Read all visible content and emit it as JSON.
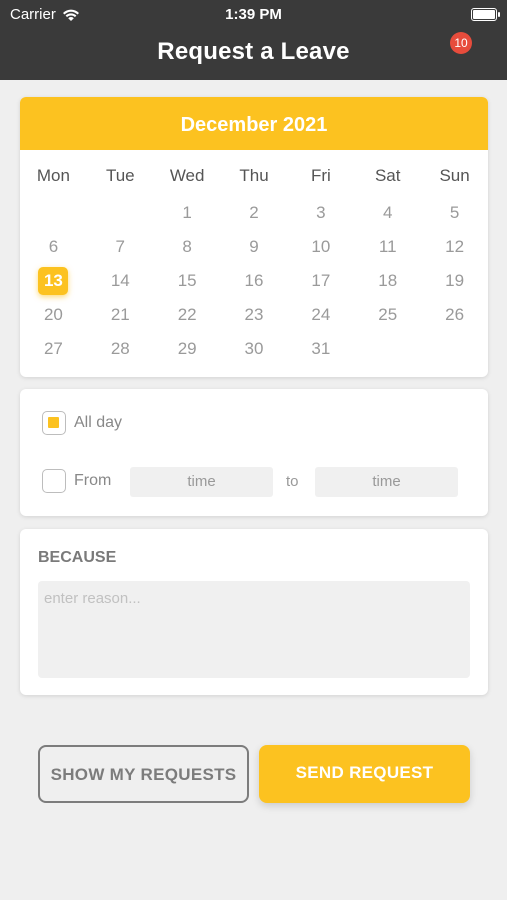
{
  "status_bar": {
    "carrier": "Carrier",
    "time": "1:39 PM"
  },
  "header": {
    "title": "Request a Leave",
    "badge_count": "10"
  },
  "calendar": {
    "month": "December 2021",
    "weekdays": [
      "Mon",
      "Tue",
      "Wed",
      "Thu",
      "Fri",
      "Sat",
      "Sun"
    ],
    "weeks": [
      [
        "",
        "",
        "1",
        "2",
        "3",
        "4",
        "5"
      ],
      [
        "6",
        "7",
        "8",
        "9",
        "10",
        "11",
        "12"
      ],
      [
        "13",
        "14",
        "15",
        "16",
        "17",
        "18",
        "19"
      ],
      [
        "20",
        "21",
        "22",
        "23",
        "24",
        "25",
        "26"
      ],
      [
        "27",
        "28",
        "29",
        "30",
        "31",
        "",
        ""
      ]
    ],
    "selected_day": "13"
  },
  "time_options": {
    "all_day_label": "All day",
    "all_day_checked": true,
    "from_label": "From",
    "from_checked": false,
    "from_placeholder": "time",
    "to_label": "to",
    "to_placeholder": "time"
  },
  "reason": {
    "label": "BECAUSE",
    "placeholder": "enter reason..."
  },
  "actions": {
    "show_label": "SHOW MY REQUESTS",
    "send_label": "SEND REQUEST"
  },
  "colors": {
    "accent": "#fcc220",
    "header_bg": "#3a3a3a",
    "badge": "#e74c3c"
  }
}
